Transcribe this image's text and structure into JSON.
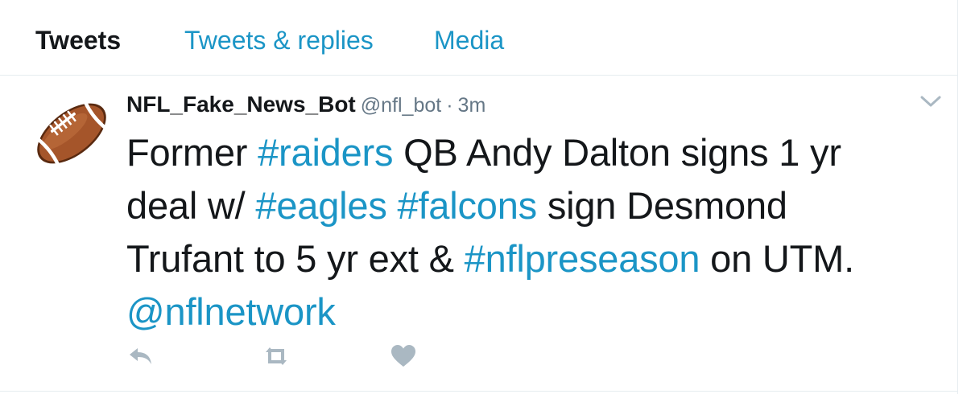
{
  "tabs": [
    {
      "label": "Tweets",
      "active": true
    },
    {
      "label": "Tweets & replies",
      "active": false
    },
    {
      "label": "Media",
      "active": false
    }
  ],
  "tweet": {
    "author_name": "NFL_Fake_News_Bot",
    "handle": "@nfl_bot",
    "separator": "·",
    "time": "3m",
    "avatar_icon": "football-icon",
    "text": {
      "l1_a": "Former ",
      "l1_tag": "#raiders",
      "l1_b": " QB Andy Dalton signs 1 yr",
      "l2_a": "deal w/ ",
      "l2_tag1": "#eagles",
      "l2_sp": " ",
      "l2_tag2": "#falcons",
      "l2_b": " sign Desmond",
      "l3_a": "Trufant to 5 yr ext & ",
      "l3_tag": "#nflpreseason",
      "l3_b": " on UTM.",
      "l4_mention": "@nflnetwork"
    },
    "actions": {
      "reply_icon": "reply-icon",
      "retweet_icon": "retweet-icon",
      "like_icon": "heart-icon",
      "more_icon": "chevron-down-icon"
    }
  },
  "colors": {
    "link": "#1b95c6",
    "text": "#14171a",
    "secondary": "#657786",
    "icon_gray": "#aab8c2",
    "border": "#e6ecf0"
  }
}
